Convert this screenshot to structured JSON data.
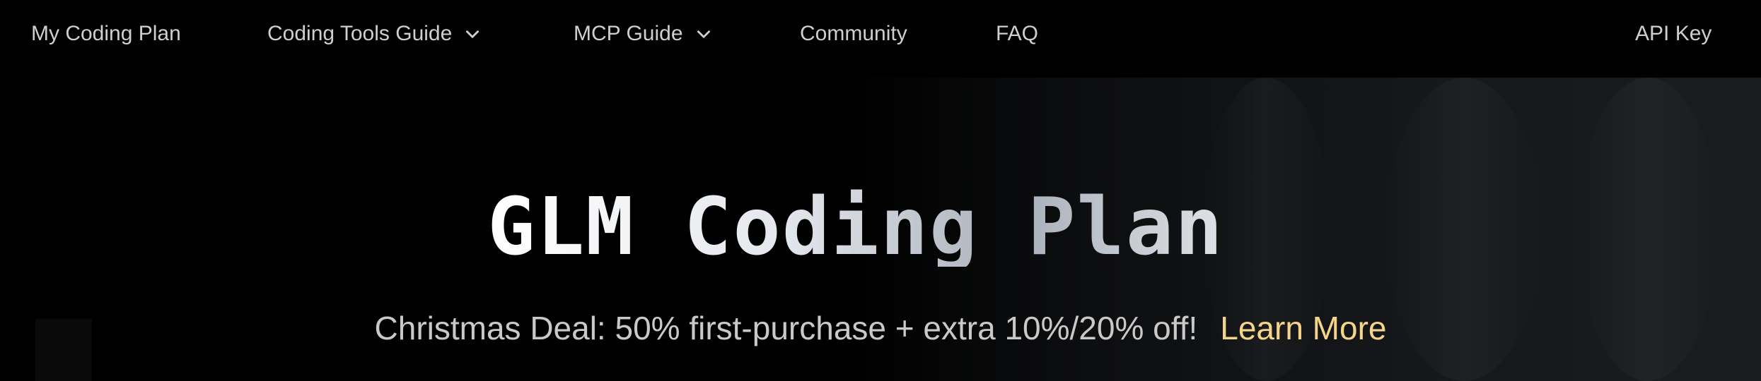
{
  "nav": {
    "items": [
      {
        "label": "My Coding Plan",
        "has_dropdown": false
      },
      {
        "label": "Coding Tools Guide",
        "has_dropdown": true
      },
      {
        "label": "MCP Guide",
        "has_dropdown": true
      },
      {
        "label": "Community",
        "has_dropdown": false
      },
      {
        "label": "FAQ",
        "has_dropdown": false
      }
    ],
    "api_key_label": "API Key",
    "dropdown_icon": "chevron-down-icon"
  },
  "hero": {
    "title": "GLM Coding Plan",
    "promo_text": "Christmas Deal: 50% first-purchase + extra 10%/20% off!",
    "promo_link_label": "Learn More"
  },
  "colors": {
    "background": "#000000",
    "nav_text": "#cfcfcf",
    "promo_text": "#c9c9c9",
    "link_accent": "#f5d58a"
  }
}
